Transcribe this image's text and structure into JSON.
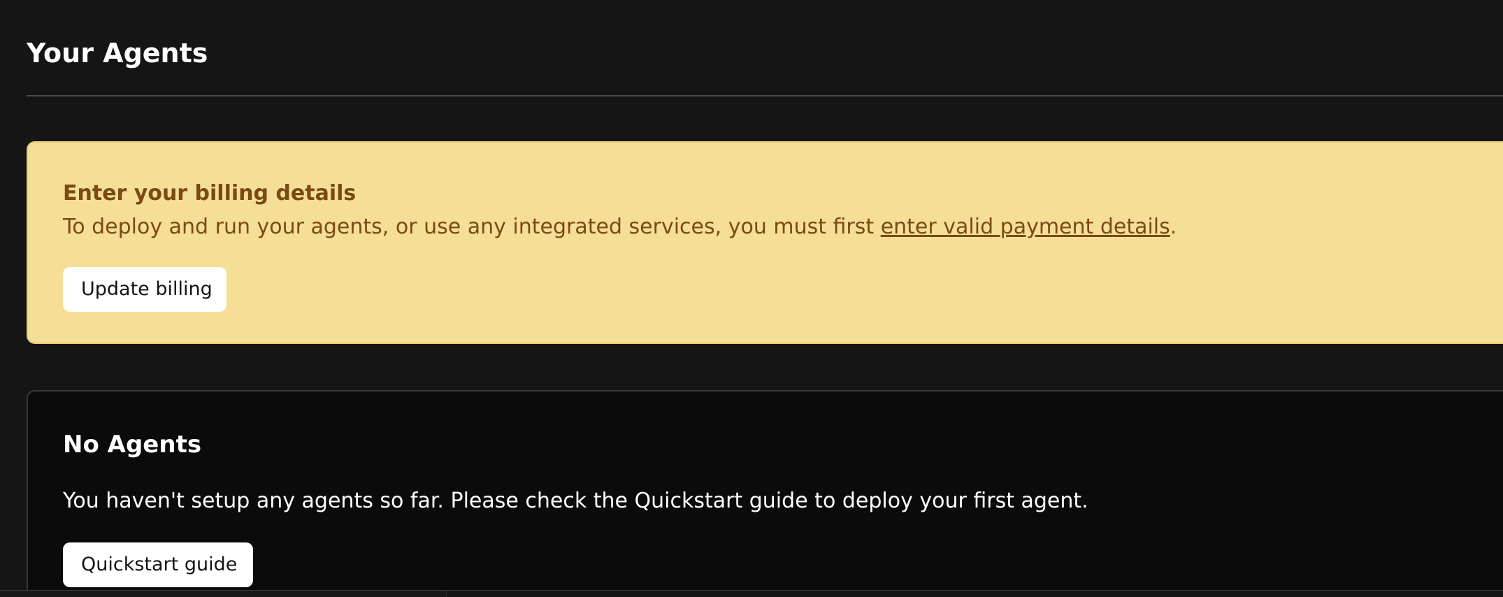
{
  "header": {
    "title": "Your Agents"
  },
  "billing_alert": {
    "title": "Enter your billing details",
    "description_prefix": "To deploy and run your agents, or use any integrated services, you must first ",
    "link_text": "enter valid payment details",
    "description_suffix": ".",
    "button_label": "Update billing",
    "background_color": "#f5df97",
    "text_color": "#7a4a12"
  },
  "agents_panel": {
    "title": "No Agents",
    "message": "You haven't setup any agents so far. Please check the Quickstart guide to deploy your first agent.",
    "button_label": "Quickstart guide",
    "background_color": "#0b0b0b"
  },
  "theme": {
    "page_background": "#151515",
    "button_background": "#ffffff",
    "button_text": "#141414"
  }
}
